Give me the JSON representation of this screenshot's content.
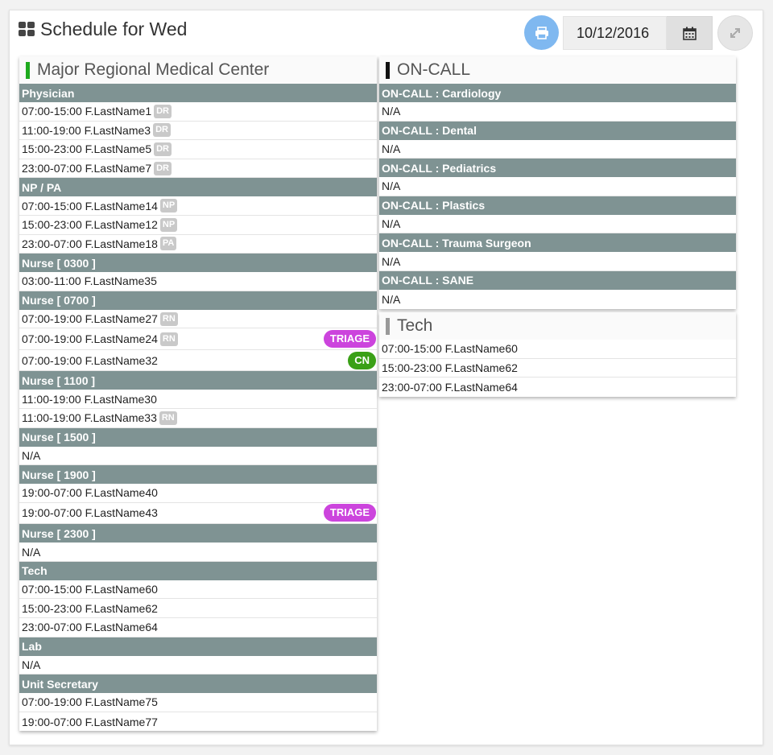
{
  "header": {
    "title": "Schedule for Wed",
    "date_value": "10/12/2016"
  },
  "colors": {
    "accent_green": "#1eaa1e",
    "section_gray": "#7f9393",
    "triage": "#cc44dd",
    "cn": "#3aa017",
    "print": "#7fb8f0"
  },
  "left_panel": {
    "title": "Major Regional Medical Center",
    "sections": [
      {
        "name": "Physician",
        "rows": [
          {
            "text": "07:00-15:00 F.LastName1",
            "tag": "DR"
          },
          {
            "text": "11:00-19:00 F.LastName3",
            "tag": "DR"
          },
          {
            "text": "15:00-23:00 F.LastName5",
            "tag": "DR"
          },
          {
            "text": "23:00-07:00 F.LastName7",
            "tag": "DR"
          }
        ]
      },
      {
        "name": "NP / PA",
        "rows": [
          {
            "text": "07:00-15:00 F.LastName14",
            "tag": "NP"
          },
          {
            "text": "15:00-23:00 F.LastName12",
            "tag": "NP"
          },
          {
            "text": "23:00-07:00 F.LastName18",
            "tag": "PA"
          }
        ]
      },
      {
        "name": "Nurse [ 0300 ]",
        "rows": [
          {
            "text": "03:00-11:00 F.LastName35"
          }
        ]
      },
      {
        "name": "Nurse [ 0700 ]",
        "rows": [
          {
            "text": "07:00-19:00 F.LastName27",
            "tag": "RN"
          },
          {
            "text": "07:00-19:00 F.LastName24",
            "tag": "RN",
            "badge": "TRIAGE",
            "badge_type": "triage"
          },
          {
            "text": "07:00-19:00 F.LastName32",
            "badge": "CN",
            "badge_type": "cn"
          }
        ]
      },
      {
        "name": "Nurse [ 1100 ]",
        "rows": [
          {
            "text": "11:00-19:00 F.LastName30"
          },
          {
            "text": "11:00-19:00 F.LastName33",
            "tag": "RN"
          }
        ]
      },
      {
        "name": "Nurse [ 1500 ]",
        "rows": [
          {
            "text": "N/A"
          }
        ]
      },
      {
        "name": "Nurse [ 1900 ]",
        "rows": [
          {
            "text": "19:00-07:00 F.LastName40"
          },
          {
            "text": "19:00-07:00 F.LastName43",
            "badge": "TRIAGE",
            "badge_type": "triage"
          }
        ]
      },
      {
        "name": "Nurse [ 2300 ]",
        "rows": [
          {
            "text": "N/A"
          }
        ]
      },
      {
        "name": "Tech",
        "rows": [
          {
            "text": "07:00-15:00 F.LastName60"
          },
          {
            "text": "15:00-23:00 F.LastName62"
          },
          {
            "text": "23:00-07:00 F.LastName64"
          }
        ]
      },
      {
        "name": "Lab",
        "rows": [
          {
            "text": "N/A"
          }
        ]
      },
      {
        "name": "Unit Secretary",
        "rows": [
          {
            "text": "07:00-19:00 F.LastName75"
          },
          {
            "text": "19:00-07:00 F.LastName77"
          }
        ]
      }
    ]
  },
  "oncall_panel": {
    "title": "ON-CALL",
    "sections": [
      {
        "name": "ON-CALL : Cardiology",
        "rows": [
          {
            "text": "N/A"
          }
        ]
      },
      {
        "name": "ON-CALL : Dental",
        "rows": [
          {
            "text": "N/A"
          }
        ]
      },
      {
        "name": "ON-CALL : Pediatrics",
        "rows": [
          {
            "text": "N/A"
          }
        ]
      },
      {
        "name": "ON-CALL : Plastics",
        "rows": [
          {
            "text": "N/A"
          }
        ]
      },
      {
        "name": "ON-CALL : Trauma Surgeon",
        "rows": [
          {
            "text": "N/A"
          }
        ]
      },
      {
        "name": "ON-CALL : SANE",
        "rows": [
          {
            "text": "N/A"
          }
        ]
      }
    ]
  },
  "tech_panel": {
    "title": "Tech",
    "rows": [
      {
        "text": "07:00-15:00 F.LastName60"
      },
      {
        "text": "15:00-23:00 F.LastName62"
      },
      {
        "text": "23:00-07:00 F.LastName64"
      }
    ]
  }
}
